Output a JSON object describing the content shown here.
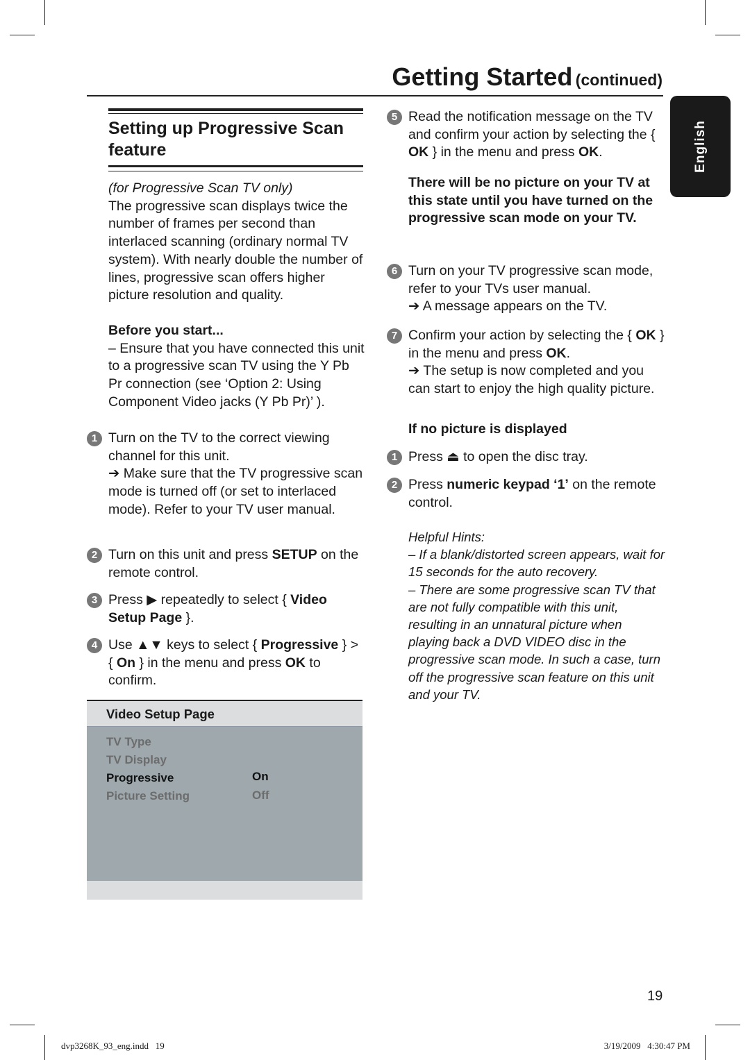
{
  "header": {
    "title": "Getting Started",
    "subtitle": "(continued)"
  },
  "language_tab": "English",
  "left": {
    "section_title": "Setting up Progressive Scan feature",
    "intro_note": "(for Progressive Scan TV only)",
    "intro": "The progressive scan displays twice the number of frames per second than interlaced scanning (ordinary normal TV system). With nearly double the number of lines, progressive scan offers higher picture resolution and quality.",
    "before_title": "Before you start...",
    "before_text": "–  Ensure that you have connected this unit to a progressive scan TV using the Y Pb Pr connection (see ‘Option 2: Using Component Video jacks (Y Pb Pr)’ ).",
    "steps": [
      {
        "n": "1",
        "a": "Turn on the TV to the correct viewing channel for this unit.",
        "result": "Make sure that the TV progressive scan mode is turned off (or set to interlaced mode). Refer to your TV user manual."
      },
      {
        "n": "2",
        "a": "Turn on this unit and press ",
        "b": "SETUP",
        "c": " on the remote control."
      },
      {
        "n": "3",
        "a": "Press ",
        "icon": "▶",
        "b": " repeatedly to select { ",
        "c": "Video Setup Page",
        "d": " }."
      },
      {
        "n": "4",
        "a": "Use ",
        "icon": "▲▼",
        "b": " keys to select { ",
        "c": "Progressive",
        "d": " } > { ",
        "e": "On",
        "f": " } in the menu and press ",
        "g": "OK",
        "h": " to confirm."
      }
    ]
  },
  "menu": {
    "title": "Video Setup Page",
    "items": [
      {
        "label": "TV Type",
        "value": "",
        "active": false
      },
      {
        "label": "TV Display",
        "value": "",
        "active": false
      },
      {
        "label": "Progressive",
        "value": "On",
        "active": true
      },
      {
        "label": "Picture Setting",
        "value": "Off",
        "active": false
      }
    ],
    "colors": {
      "header": "#dcdddf",
      "body": "#9fa9ad",
      "footer": "#dcdddf",
      "active": "#111111",
      "inactive": "#6c6c6c"
    }
  },
  "right": {
    "step5": {
      "n": "5",
      "a": "Read the notification message on the TV and confirm your action by selecting the { ",
      "b": "OK",
      "c": " } in the menu and press ",
      "d": "OK",
      "e": "."
    },
    "warning": "There will be no picture on your TV at this state until you have turned on the progressive scan mode on your TV.",
    "step6": {
      "n": "6",
      "a": "Turn on your TV progressive scan mode, refer to your TVs user manual.",
      "result": "A message appears on the TV."
    },
    "step7": {
      "n": "7",
      "a": "Confirm your action by selecting the { ",
      "b": "OK",
      "c": " } in the menu and press ",
      "d": "OK",
      "e": ".",
      "result": "The setup is now completed and you can start to enjoy the high quality picture."
    },
    "no_picture_title": "If no picture is displayed",
    "np1": {
      "n": "1",
      "a": "Press ",
      "icon": "⏏",
      "b": " to open the disc tray."
    },
    "np2": {
      "n": "2",
      "a": "Press ",
      "b": "numeric keypad ‘1’",
      "c": " on the remote control."
    },
    "hints_title": "Helpful Hints:",
    "hint1": "–  If a blank/distorted screen appears, wait for 15 seconds for the auto recovery.",
    "hint2": "–  There are some progressive scan TV that are not fully compatible with this unit, resulting in an unnatural picture when playing back a DVD VIDEO disc in the progressive scan mode. In such a case, turn off the progressive scan feature on this unit and your TV."
  },
  "page_number": "19",
  "footer": {
    "file": "dvp3268K_93_eng.indd   19",
    "date": "3/19/2009   4:30:47 PM"
  }
}
